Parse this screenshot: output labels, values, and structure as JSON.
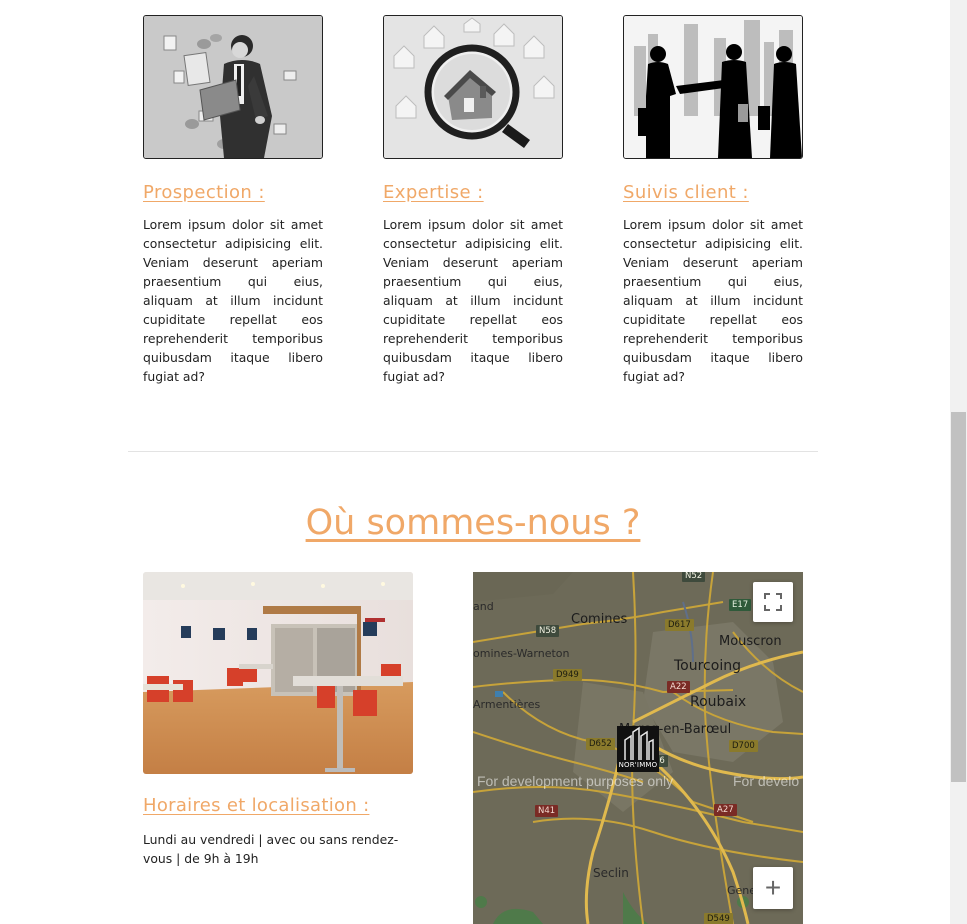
{
  "services": [
    {
      "title": "Prospection :",
      "text": "Lorem ipsum dolor sit amet consectetur adipisicing elit. Veniam deserunt aperiam praesentium qui eius, aliquam at illum incidunt cupiditate repellat eos reprehenderit temporibus quibusdam itaque libero fugiat ad?",
      "icon": "businessman-paperwork-icon"
    },
    {
      "title": "Expertise :",
      "text": "Lorem ipsum dolor sit amet consectetur adipisicing elit. Veniam deserunt aperiam praesentium qui eius, aliquam at illum incidunt cupiditate repellat eos reprehenderit temporibus quibusdam itaque libero fugiat ad?",
      "icon": "magnifier-house-icon"
    },
    {
      "title": "Suivis client :",
      "text": "Lorem ipsum dolor sit amet consectetur adipisicing elit. Veniam deserunt aperiam praesentium qui eius, aliquam at illum incidunt cupiditate repellat eos reprehenderit temporibus quibusdam itaque libero fugiat ad?",
      "icon": "handshake-silhouette-icon"
    }
  ],
  "location": {
    "title": "Où sommes-nous ?",
    "hours_heading": "Horaires et localisation :",
    "hours_text": "Lundi au vendredi | avec ou sans rendez-vous | de 9h à 19h"
  },
  "map": {
    "watermark": "For development purposes only",
    "watermark_right": "For develo",
    "marker_label": "NOR'IMMO",
    "zoom_in": "+",
    "places": {
      "land": "and",
      "comines": "Comines",
      "comines_warneton": "omines-Warneton",
      "mouscron": "Mouscron",
      "tourcoing": "Tourcoing",
      "roubaix": "Roubaix",
      "armentieres": "Armentières",
      "marcq": "Marcq-en-Barœul",
      "seclin": "Seclin",
      "gene": "Gene"
    },
    "roads": {
      "n58": "N58",
      "d617": "D617",
      "e17": "E17",
      "d949": "D949",
      "a22": "A22",
      "d652": "D652",
      "d700": "D700",
      "n41": "N41",
      "a27": "A27",
      "d549": "D549",
      "n52": "N52",
      "n56": "56"
    }
  },
  "colors": {
    "accent": "#f0a868",
    "text": "#222222",
    "divider": "#e3e3e3"
  }
}
